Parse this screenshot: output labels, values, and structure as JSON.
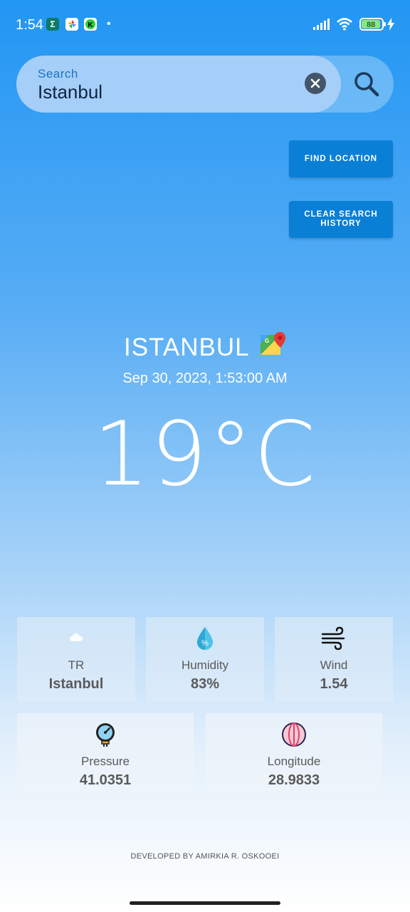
{
  "status_bar": {
    "time": "1:54",
    "battery": "88",
    "app_icons": [
      "Σ",
      "",
      "K"
    ]
  },
  "search": {
    "label": "Search",
    "value": "Istanbul"
  },
  "buttons": {
    "find_location": "FIND LOCATION",
    "clear_history": "CLEAR SEARCH HISTORY"
  },
  "weather": {
    "city": "ISTANBUL",
    "datetime": "Sep 30, 2023, 1:53:00 AM",
    "temperature": "19°C"
  },
  "cards": {
    "country": {
      "title": "TR",
      "value": "Istanbul",
      "icon": "cloud-icon"
    },
    "humidity": {
      "title": "Humidity",
      "value": "83%",
      "icon": "humidity-drop-icon"
    },
    "wind": {
      "title": "Wind",
      "value": "1.54",
      "icon": "wind-icon"
    },
    "pressure": {
      "title": "Pressure",
      "value": "41.0351",
      "icon": "pressure-gauge-icon"
    },
    "longitude": {
      "title": "Longitude",
      "value": "28.9833",
      "icon": "globe-icon"
    }
  },
  "footer": "DEVELOPED BY AMIRKIA R. OSKOOEI",
  "colors": {
    "primary": "#2196f3",
    "button": "#0a7fd6"
  }
}
